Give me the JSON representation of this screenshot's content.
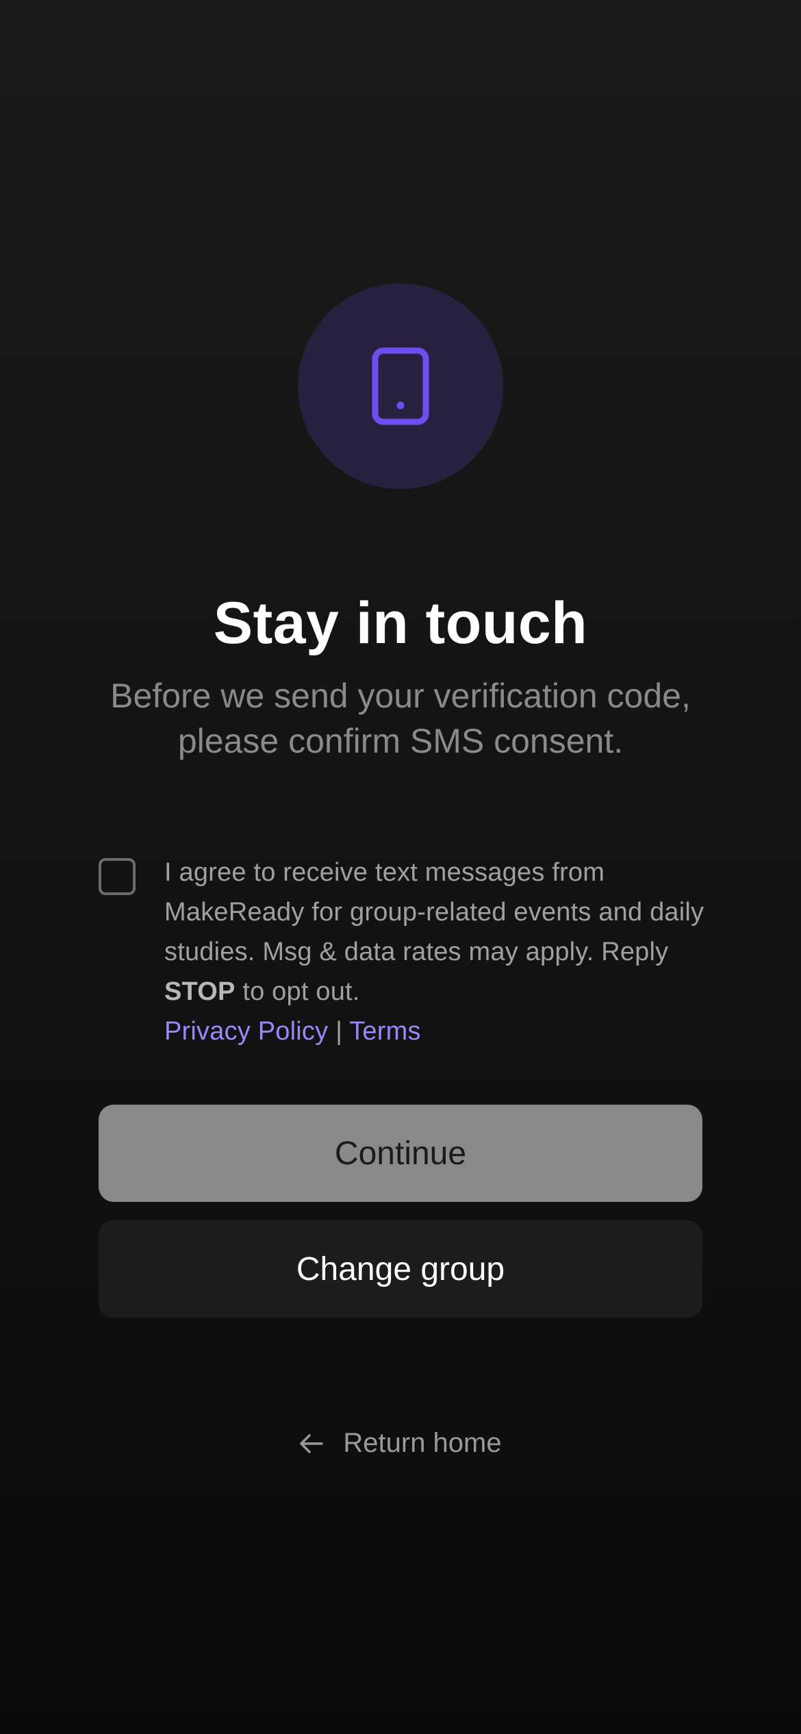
{
  "hero": {
    "icon": "phone-icon",
    "accent_color": "#6d4ef0",
    "circle_color": "#27213f"
  },
  "title": "Stay in touch",
  "subtitle": "Before we send your verification code, please confirm SMS consent.",
  "consent": {
    "checked": false,
    "text_before": "I agree to receive text messages from MakeReady for group-related events and daily studies. Msg & data rates may apply. Reply ",
    "stop_word": "STOP",
    "text_after": " to opt out.",
    "privacy_link": "Privacy Policy",
    "separator": "|",
    "terms_link": "Terms"
  },
  "buttons": {
    "continue_label": "Continue",
    "change_group_label": "Change group"
  },
  "footer": {
    "return_home_label": "Return home",
    "icon": "arrow-left-icon"
  }
}
